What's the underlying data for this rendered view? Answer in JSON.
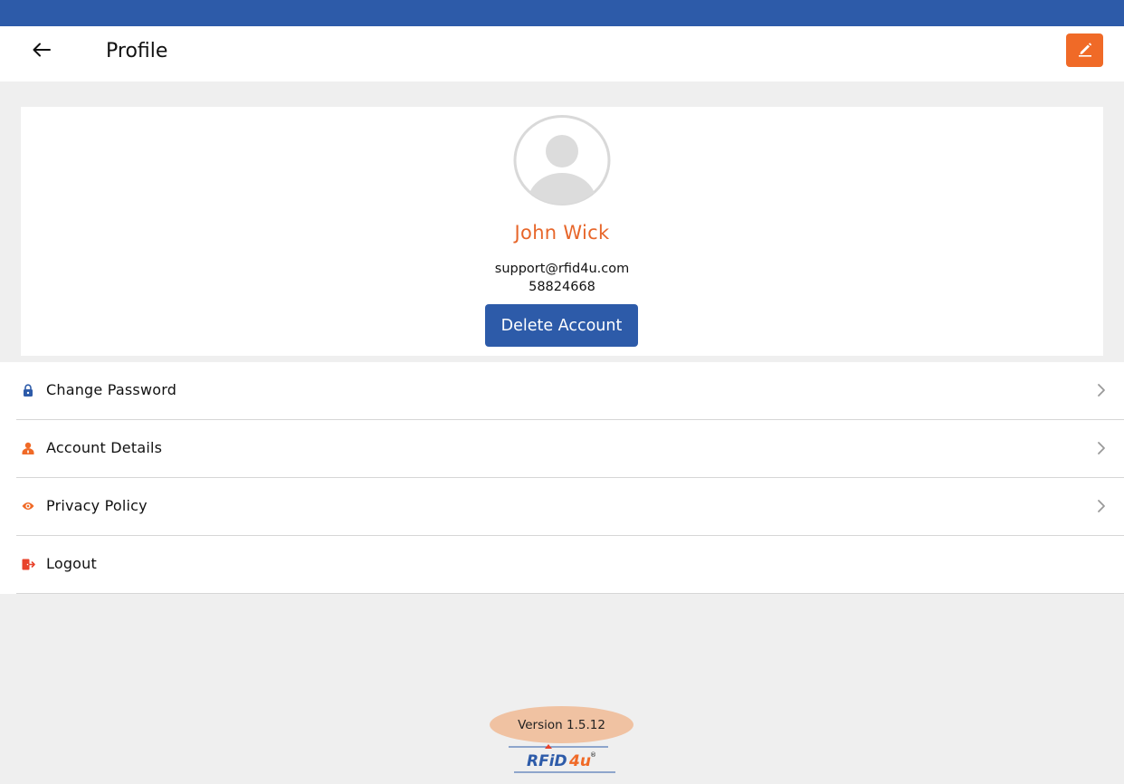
{
  "header": {
    "title": "Profile",
    "back_icon": "arrow-left-icon",
    "edit_icon": "pencil-icon",
    "edit_color": "#f06a27",
    "status_bar_color": "#2d5ba9"
  },
  "profile": {
    "avatar_icon": "user-avatar-placeholder-icon",
    "name": "John Wick",
    "email": "support@rfid4u.com",
    "phone": "58824668",
    "delete_label": "Delete Account",
    "name_color": "#e7662a",
    "button_color": "#2d5ba9"
  },
  "menu": {
    "items": [
      {
        "label": "Change Password",
        "icon": "lock-icon",
        "icon_color": "#2d5ba9",
        "chevron": true
      },
      {
        "label": "Account Details",
        "icon": "user-icon",
        "icon_color": "#f06a27",
        "chevron": true
      },
      {
        "label": "Privacy Policy",
        "icon": "privacy-eye-icon",
        "icon_color": "#f06a27",
        "chevron": true
      },
      {
        "label": "Logout",
        "icon": "logout-icon",
        "icon_color": "#e8432c",
        "chevron": false
      }
    ]
  },
  "footer": {
    "version": "Version 1.5.12",
    "logo_text": "RFiD4u",
    "logo_mark": "®"
  }
}
